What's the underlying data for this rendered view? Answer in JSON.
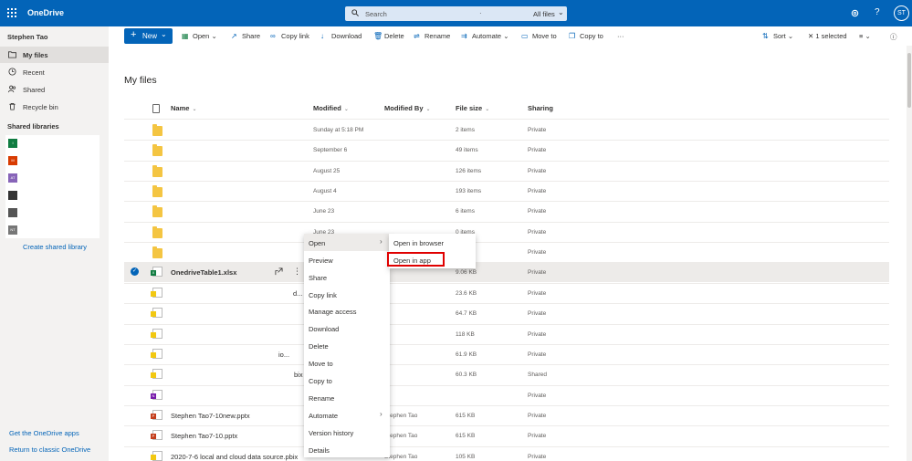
{
  "topbar": {
    "app_title": "OneDrive",
    "search_placeholder": "Search",
    "search_dot": "·",
    "search_scope": "All files",
    "help": "?",
    "avatar_initials": "ST",
    "bar_color": "#0364b8"
  },
  "sidebar": {
    "user_name": "Stephen Tao",
    "items": [
      {
        "label": "My files",
        "icon": "folder-icon",
        "active": true
      },
      {
        "label": "Recent",
        "icon": "clock-icon"
      },
      {
        "label": "Shared",
        "icon": "people-icon"
      },
      {
        "label": "Recycle bin",
        "icon": "trash-icon"
      }
    ],
    "shared_libraries_title": "Shared libraries",
    "libraries": [
      {
        "letter": "I",
        "color": "#107c41"
      },
      {
        "letter": "M",
        "color": "#d83b01"
      },
      {
        "letter": "AT",
        "color": "#8764b8"
      },
      {
        "letter": "",
        "color": "#333333"
      },
      {
        "letter": "",
        "color": "#555555"
      },
      {
        "letter": "NT",
        "color": "#777777"
      }
    ],
    "create_library": "Create shared library",
    "get_apps": "Get the OneDrive apps",
    "classic": "Return to classic OneDrive"
  },
  "commandbar": {
    "new_label": "New",
    "open": "Open",
    "share": "Share",
    "copy_link": "Copy link",
    "download": "Download",
    "delete": "Delete",
    "rename": "Rename",
    "automate": "Automate",
    "move_to": "Move to",
    "copy_to": "Copy to",
    "more": "···",
    "sort": "Sort",
    "selected": "1 selected"
  },
  "main": {
    "title": "My files",
    "columns": {
      "name": "Name",
      "modified": "Modified",
      "modified_by": "Modified By",
      "file_size": "File size",
      "sharing": "Sharing"
    },
    "rows": [
      {
        "name": "",
        "modified": "Sunday at 5:18 PM",
        "modified_by": "",
        "size": "2 items",
        "sharing": "Private",
        "type": "folder"
      },
      {
        "name": "",
        "modified": "September 6",
        "modified_by": "",
        "size": "49 items",
        "sharing": "Private",
        "type": "folder"
      },
      {
        "name": "",
        "modified": "August 25",
        "modified_by": "",
        "size": "126 items",
        "sharing": "Private",
        "type": "folder"
      },
      {
        "name": "",
        "modified": "August 4",
        "modified_by": "",
        "size": "193 items",
        "sharing": "Private",
        "type": "folder"
      },
      {
        "name": "",
        "modified": "June 23",
        "modified_by": "",
        "size": "6 items",
        "sharing": "Private",
        "type": "folder"
      },
      {
        "name": "",
        "modified": "June 23",
        "modified_by": "",
        "size": "0 items",
        "sharing": "Private",
        "type": "folder"
      },
      {
        "name": "",
        "modified": "",
        "modified_by": "",
        "size": "",
        "sharing": "Private",
        "type": "folder"
      },
      {
        "name": "OnedriveTable1.xlsx",
        "modified": "",
        "modified_by": "",
        "size": "9.06 KB",
        "sharing": "Private",
        "type": "xlsx",
        "selected": true
      },
      {
        "name": "",
        "frag": "d...",
        "modified": "",
        "modified_by": "",
        "size": "23.6 KB",
        "sharing": "Private",
        "type": "pbix"
      },
      {
        "name": "",
        "modified": "",
        "modified_by": "",
        "size": "64.7 KB",
        "sharing": "Private",
        "type": "pbix"
      },
      {
        "name": "",
        "modified": "",
        "modified_by": "",
        "size": "118 KB",
        "sharing": "Private",
        "type": "pbix"
      },
      {
        "name": "",
        "frag": "io...",
        "modified": "",
        "modified_by": "",
        "size": "61.9 KB",
        "sharing": "Private",
        "type": "pbix"
      },
      {
        "name": "",
        "frag": "bix",
        "modified": "",
        "modified_by": "",
        "size": "60.3 KB",
        "sharing": "Shared",
        "type": "pbix"
      },
      {
        "name": "",
        "modified": "",
        "modified_by": "",
        "size": "",
        "sharing": "Private",
        "type": "onenote"
      },
      {
        "name": "Stephen Tao7-10new.pptx",
        "modified": "",
        "modified_by": "Stephen Tao",
        "size": "615 KB",
        "sharing": "Private",
        "type": "pptx"
      },
      {
        "name": "Stephen Tao7-10.pptx",
        "modified": "",
        "modified_by": "Stephen Tao",
        "size": "615 KB",
        "sharing": "Private",
        "type": "pptx"
      },
      {
        "name": "2020-7-6 local and cloud data source.pbix",
        "modified": "",
        "modified_by": "Stephen Tao",
        "size": "105 KB",
        "sharing": "Private",
        "type": "pbix"
      }
    ]
  },
  "context_menu": {
    "items": [
      "Open",
      "Preview",
      "Share",
      "Copy link",
      "Manage access",
      "Download",
      "Delete",
      "Move to",
      "Copy to",
      "Rename",
      "Automate",
      "Version history",
      "Details"
    ]
  },
  "submenu": {
    "items": [
      "Open in browser",
      "Open in app"
    ]
  }
}
